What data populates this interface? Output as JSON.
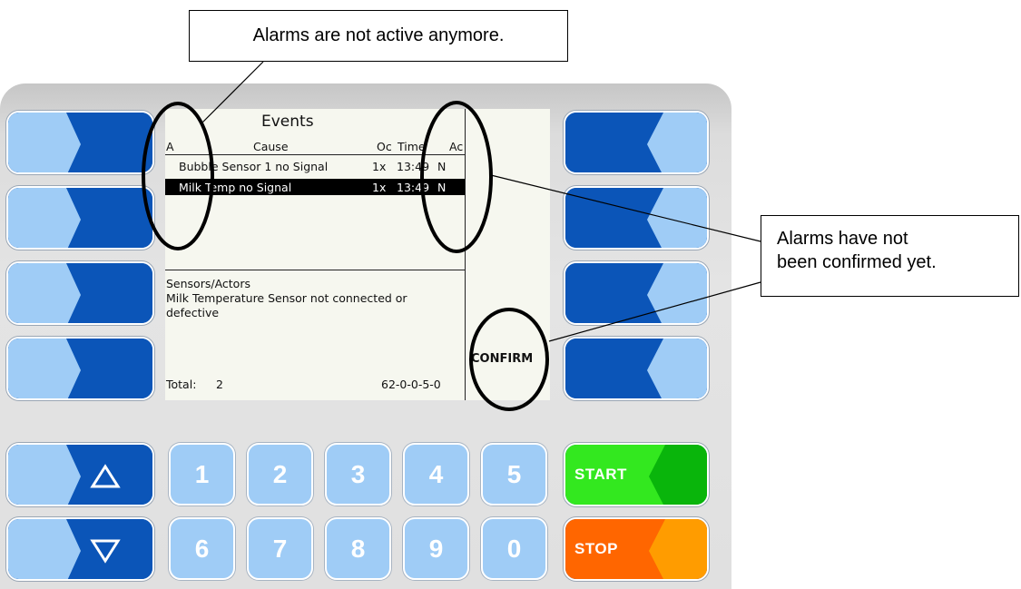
{
  "screen": {
    "title": "Events",
    "columns": [
      "A",
      "Cause",
      "Oc",
      "Time",
      "Ac"
    ],
    "rows": [
      {
        "cause": "Bubble Sensor 1 no Signal",
        "occurrence": "1x",
        "time": "13:49",
        "ack": "N",
        "selected": false
      },
      {
        "cause": "Milk Temp no Signal",
        "occurrence": "1x",
        "time": "13:49",
        "ack": "N",
        "selected": true
      }
    ],
    "detail_category": "Sensors/Actors",
    "detail_line1": "Milk Temperature Sensor not connected or",
    "detail_line2": "defective",
    "total_label": "Total:",
    "total_value": "2",
    "code": "62-0-0-5-0",
    "softkey_confirm": "CONFIRM"
  },
  "keypad": {
    "row1": [
      "1",
      "2",
      "3",
      "4",
      "5"
    ],
    "row2": [
      "6",
      "7",
      "8",
      "9",
      "0"
    ],
    "start_label": "START",
    "stop_label": "STOP",
    "up_icon": "triangle-up-icon",
    "down_icon": "triangle-down-icon"
  },
  "callouts": {
    "top": "Alarms are not active anymore.",
    "right_line1": "Alarms have not",
    "right_line2": "been confirmed yet."
  },
  "colors": {
    "softkey_dark": "#0b55b8",
    "softkey_light": "#9fccf6",
    "start_green": "#33e81f",
    "start_dark_green": "#09b50b",
    "stop_orange": "#ff6600",
    "stop_light_orange": "#ff9c00",
    "selection": "#000000"
  }
}
